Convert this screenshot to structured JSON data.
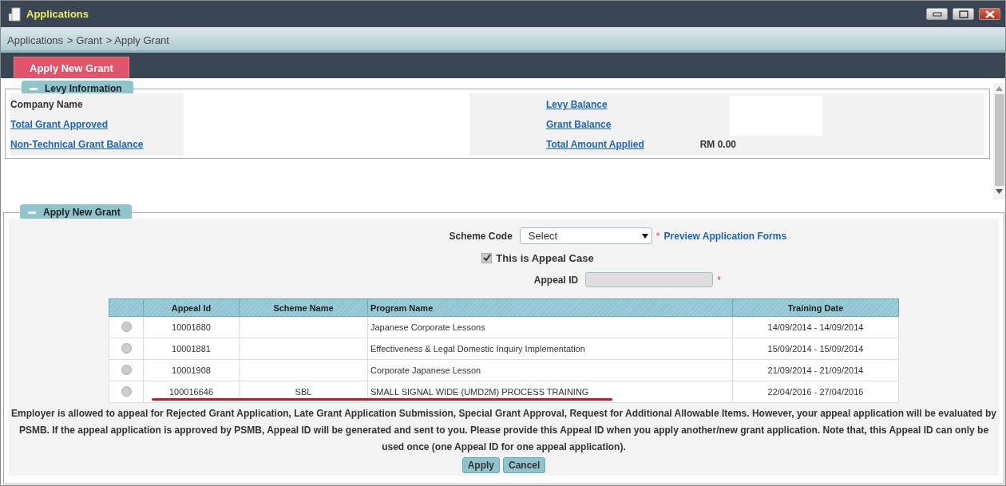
{
  "window": {
    "title": "Applications"
  },
  "breadcrumb": [
    "Applications",
    "> Grant",
    "> Apply Grant"
  ],
  "tabs": [
    {
      "label": "Apply New Grant",
      "selected": true
    }
  ],
  "levy_section": {
    "title": "Levy Information",
    "expanded": true,
    "left": [
      {
        "label": "Company Name",
        "kind": "text"
      },
      {
        "label": "Total Grant Approved",
        "kind": "link"
      },
      {
        "label": "Non-Technical Grant Balance",
        "kind": "link"
      }
    ],
    "right": [
      {
        "label": "Levy Balance",
        "kind": "link"
      },
      {
        "label": "Grant Balance",
        "kind": "link"
      },
      {
        "label": "Total Amount Applied",
        "kind": "link",
        "value": "RM 0.00"
      }
    ]
  },
  "grant_section": {
    "title": "Apply New Grant",
    "expanded": true,
    "scheme_code": {
      "label": "Scheme Code",
      "value": "Select",
      "required_mark": "*",
      "link": "Preview Application Forms"
    },
    "appeal_case": {
      "label": "This is Appeal Case",
      "checked": true
    },
    "appeal_id": {
      "label": "Appeal ID",
      "disabled": true,
      "required_mark": "*"
    },
    "table": {
      "columns": [
        "Appeal Id",
        "Scheme Name",
        "Program Name",
        "Training Date"
      ],
      "rows": [
        {
          "selected": false,
          "cells": [
            "10001880",
            "",
            "Japanese Corporate Lessons",
            "14/09/2014 - 14/09/2014"
          ]
        },
        {
          "selected": false,
          "cells": [
            "10001881",
            "",
            "Effectiveness & Legal Domestic Inquiry Implementation",
            "15/09/2014 - 15/09/2014"
          ]
        },
        {
          "selected": false,
          "cells": [
            "10001908",
            "",
            "Corporate Japanese Lesson",
            "21/09/2014 - 21/09/2014"
          ]
        },
        {
          "selected": false,
          "underlined": true,
          "cells": [
            "100016646",
            "SBL",
            "SMALL SIGNAL WIDE (UMD2M) PROCESS TRAINING",
            "22/04/2016 - 27/04/2016"
          ]
        }
      ]
    },
    "notice": "Employer is allowed to appeal for Rejected Grant Application, Late Grant Application Submission, Special Grant Approval, Request for Additional Allowable Items. However, your appeal application will be evaluated by PSMB. If the appeal application is approved by PSMB, Appeal ID will be generated and sent to you. Please provide this Appeal ID when you apply another/new grant application. Note that, this Appeal ID can only be used once (one Appeal ID for one appeal application).",
    "buttons": [
      "Apply",
      "Cancel"
    ]
  }
}
